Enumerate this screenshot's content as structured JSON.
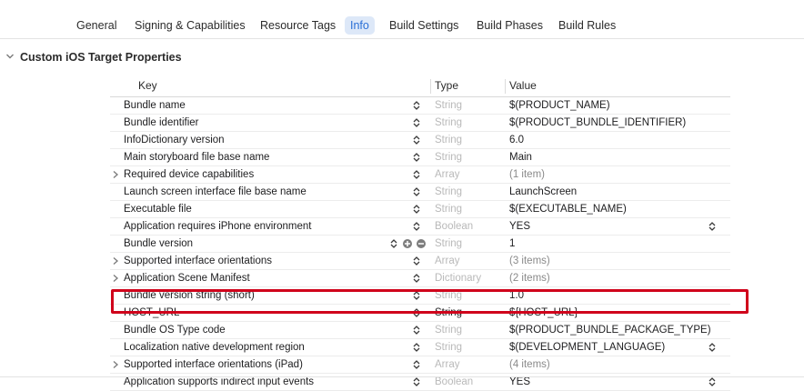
{
  "tabs": [
    {
      "label": "General",
      "active": false
    },
    {
      "label": "Signing & Capabilities",
      "active": false
    },
    {
      "label": "Resource Tags",
      "active": false
    },
    {
      "label": "Info",
      "active": true
    },
    {
      "label": "Build Settings",
      "active": false
    },
    {
      "label": "Build Phases",
      "active": false
    },
    {
      "label": "Build Rules",
      "active": false
    }
  ],
  "section": {
    "title": "Custom iOS Target Properties"
  },
  "table": {
    "headers": {
      "key": "Key",
      "type": "Type",
      "value": "Value"
    },
    "rows": [
      {
        "key": "Bundle name",
        "type": "String",
        "value": "$(PRODUCT_NAME)"
      },
      {
        "key": "Bundle identifier",
        "type": "String",
        "value": "$(PRODUCT_BUNDLE_IDENTIFIER)"
      },
      {
        "key": "InfoDictionary version",
        "type": "String",
        "value": "6.0"
      },
      {
        "key": "Main storyboard file base name",
        "type": "String",
        "value": "Main"
      },
      {
        "key": "Required device capabilities",
        "type": "Array",
        "value": "(1 item)"
      },
      {
        "key": "Launch screen interface file base name",
        "type": "String",
        "value": "LaunchScreen"
      },
      {
        "key": "Executable file",
        "type": "String",
        "value": "$(EXECUTABLE_NAME)"
      },
      {
        "key": "Application requires iPhone environment",
        "type": "Boolean",
        "value": "YES"
      },
      {
        "key": "Bundle version",
        "type": "String",
        "value": "1"
      },
      {
        "key": "Supported interface orientations",
        "type": "Array",
        "value": "(3 items)"
      },
      {
        "key": "Application Scene Manifest",
        "type": "Dictionary",
        "value": "(2 items)"
      },
      {
        "key": "Bundle version string (short)",
        "type": "String",
        "value": "1.0"
      },
      {
        "key": "HOST_URL",
        "type": "String",
        "value": "${HOST_URL}"
      },
      {
        "key": "Bundle OS Type code",
        "type": "String",
        "value": "$(PRODUCT_BUNDLE_PACKAGE_TYPE)"
      },
      {
        "key": "Localization native development region",
        "type": "String",
        "value": "$(DEVELOPMENT_LANGUAGE)"
      },
      {
        "key": "Supported interface orientations (iPad)",
        "type": "Array",
        "value": "(4 items)"
      },
      {
        "key": "Application supports indirect input events",
        "type": "Boolean",
        "value": "YES"
      }
    ]
  },
  "colors": {
    "accent": "#2a6fd6",
    "highlight_border": "#d0021b"
  }
}
